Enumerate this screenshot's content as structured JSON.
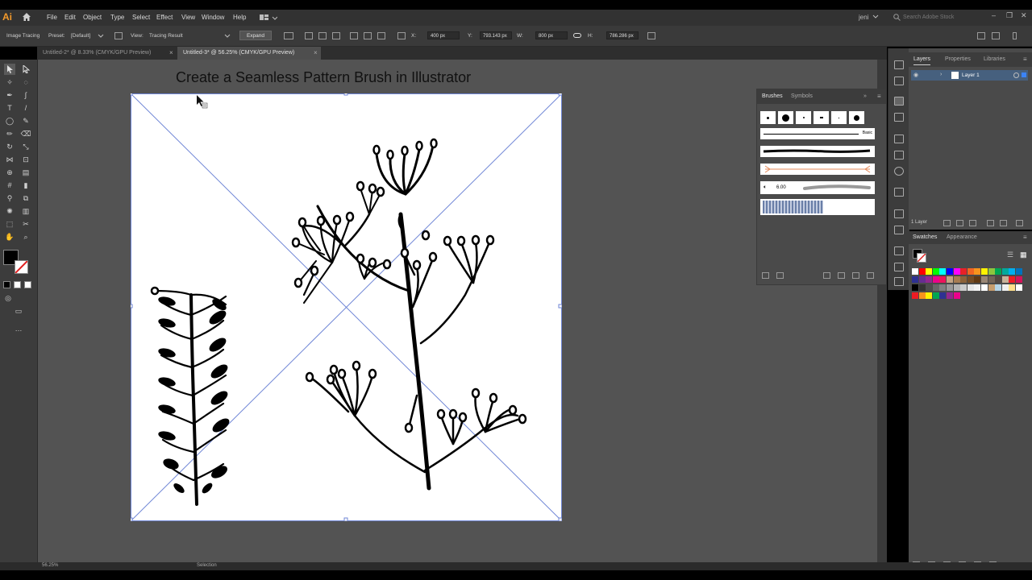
{
  "app": {
    "logo": "Ai",
    "home_icon": "home-icon",
    "menus": [
      "File",
      "Edit",
      "Object",
      "Type",
      "Select",
      "Effect",
      "View",
      "Window",
      "Help"
    ],
    "user": "jeni",
    "search_placeholder": "Search Adobe Stock"
  },
  "control_bar": {
    "mode_label": "Image Tracing",
    "preset_label": "Preset:",
    "preset_value": "[Default]",
    "view_label": "View:",
    "view_value": "Tracing Result",
    "expand_label": "Expand",
    "x_label": "X:",
    "x_value": "400 px",
    "y_label": "Y:",
    "y_value": "793.143 px",
    "w_label": "W:",
    "w_value": "800 px",
    "h_label": "H:",
    "h_value": "786.286 px"
  },
  "tabs": [
    {
      "label": "Untitled-2* @ 8.33% (CMYK/GPU Preview)",
      "active": false
    },
    {
      "label": "Untitled-3* @ 56.25% (CMYK/GPU Preview)",
      "active": true
    }
  ],
  "canvas": {
    "headline": "Create a Seamless Pattern Brush in Illustrator"
  },
  "status_bar": {
    "zoom": "56.25%",
    "tool": "Selection"
  },
  "brushes_panel": {
    "tabs": [
      "Brushes",
      "Symbols"
    ],
    "basic_label": "Basic",
    "brush_size": "6.00"
  },
  "layers_panel": {
    "tabs": [
      "Layers",
      "Properties",
      "Libraries"
    ],
    "layer_name": "Layer 1",
    "layer_count": "1 Layer"
  },
  "swatches_panel": {
    "tabs": [
      "Swatches",
      "Appearance"
    ]
  },
  "colors": {
    "accent_tab_underline": "#d0d0d0",
    "layer_selection": "#46607e",
    "tracing_bbox": "#6f86d6"
  }
}
